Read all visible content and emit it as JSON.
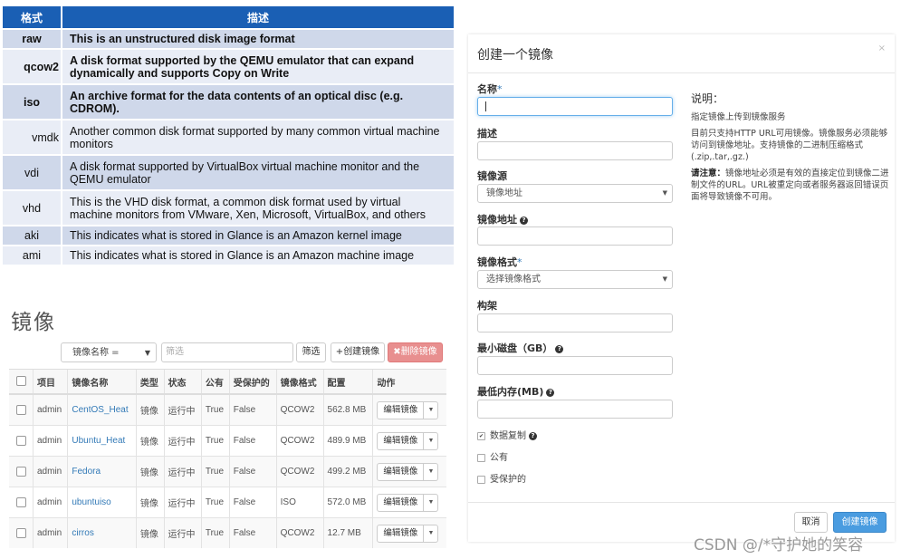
{
  "format_table": {
    "headers": [
      "格式",
      "描述"
    ],
    "rows": [
      {
        "name": "raw",
        "desc": "This is an unstructured disk image format"
      },
      {
        "name": "qcow2",
        "desc": "A disk format supported by the QEMU emulator that can expand dynamically and supports Copy on Write"
      },
      {
        "name": "iso",
        "desc": "An archive format for the data contents of an optical disc (e.g. CDROM)."
      },
      {
        "name": "vmdk",
        "desc": "Another common disk format supported by many common virtual machine monitors"
      },
      {
        "name": "vdi",
        "desc": "A disk format supported by VirtualBox virtual machine monitor and the QEMU emulator"
      },
      {
        "name": "vhd",
        "desc": "This is the VHD disk format, a common disk format used by virtual machine monitors from VMware, Xen, Microsoft, VirtualBox, and others"
      },
      {
        "name": "aki",
        "desc": "This indicates what is stored in Glance is an Amazon kernel image"
      },
      {
        "name": "ami",
        "desc": "This indicates what is stored in Glance is an Amazon machine image"
      }
    ]
  },
  "images_page": {
    "title": "镜像",
    "filter_select": "镜像名称 =",
    "filter_placeholder": "筛选",
    "filter_button": "筛选",
    "create_button": "创建镜像",
    "delete_button": "删除镜像",
    "columns": [
      "项目",
      "镜像名称",
      "类型",
      "状态",
      "公有",
      "受保护的",
      "镜像格式",
      "配置",
      "动作"
    ],
    "rows": [
      {
        "project": "admin",
        "name": "CentOS_Heat",
        "type": "镜像",
        "status": "运行中",
        "public": "True",
        "protected": "False",
        "format": "QCOW2",
        "size": "562.8 MB",
        "action": "编辑镜像"
      },
      {
        "project": "admin",
        "name": "Ubuntu_Heat",
        "type": "镜像",
        "status": "运行中",
        "public": "True",
        "protected": "False",
        "format": "QCOW2",
        "size": "489.9 MB",
        "action": "编辑镜像"
      },
      {
        "project": "admin",
        "name": "Fedora",
        "type": "镜像",
        "status": "运行中",
        "public": "True",
        "protected": "False",
        "format": "QCOW2",
        "size": "499.2 MB",
        "action": "编辑镜像"
      },
      {
        "project": "admin",
        "name": "ubuntuiso",
        "type": "镜像",
        "status": "运行中",
        "public": "True",
        "protected": "False",
        "format": "ISO",
        "size": "572.0 MB",
        "action": "编辑镜像"
      },
      {
        "project": "admin",
        "name": "cirros",
        "type": "镜像",
        "status": "运行中",
        "public": "True",
        "protected": "False",
        "format": "QCOW2",
        "size": "12.7 MB",
        "action": "编辑镜像"
      }
    ]
  },
  "modal": {
    "title": "创建一个镜像",
    "close": "×",
    "name_label": "名称",
    "desc_label": "描述",
    "source_label": "镜像源",
    "source_value": "镜像地址",
    "url_label": "镜像地址",
    "format_label": "镜像格式",
    "format_value": "选择镜像格式",
    "arch_label": "构架",
    "min_disk_label": "最小磁盘（GB）",
    "min_ram_label": "最低内存(MB)",
    "copy_data_label": "数据复制",
    "public_label": "公有",
    "protected_label": "受保护的",
    "help_title": "说明：",
    "help_p1": "指定镜像上传到镜像服务",
    "help_p2": "目前只支持HTTP URL可用镜像。镜像服务必须能够访问到镜像地址。支持镜像的二进制压缩格式(.zip,.tar,.gz.)",
    "help_note_label": "请注意：",
    "help_note": "镜像地址必须是有效的直接定位到镜像二进制文件的URL。URL被重定向或者服务器返回错误页面将导致镜像不可用。",
    "cancel": "取消",
    "submit": "创建镜像"
  },
  "watermark": "CSDN @/*守护她的笑容",
  "colors": {
    "header_blue": "#1a5fb4",
    "primary": "#4a9ce0",
    "danger": "#e88f8f",
    "link": "#337ab7"
  }
}
